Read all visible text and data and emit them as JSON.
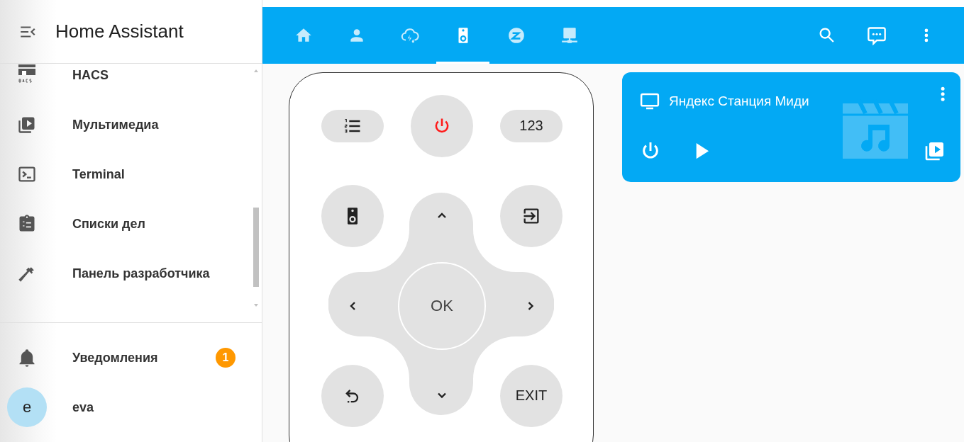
{
  "sidebar": {
    "title": "Home Assistant",
    "items": [
      {
        "label": "HACS"
      },
      {
        "label": "Мультимедиа"
      },
      {
        "label": "Terminal"
      },
      {
        "label": "Списки дел"
      },
      {
        "label": "Панель разработчика"
      }
    ],
    "notifications": {
      "label": "Уведомления",
      "badge": "1"
    },
    "user": {
      "initial": "e",
      "name": "eva"
    }
  },
  "header": {
    "tabs": [
      {
        "selected": false
      },
      {
        "selected": false
      },
      {
        "selected": false
      },
      {
        "selected": true
      },
      {
        "selected": false
      },
      {
        "selected": false
      }
    ]
  },
  "remote": {
    "keys": [
      {
        "kind": "pill"
      },
      {
        "kind": "round"
      },
      {
        "kind": "pill",
        "label": "123"
      },
      {
        "kind": "round"
      },
      {
        "kind": "arrow"
      },
      {
        "kind": "round"
      },
      {
        "kind": "arrow"
      },
      {
        "kind": "ok",
        "label": "OK"
      },
      {
        "kind": "arrow"
      },
      {
        "kind": "round"
      },
      {
        "kind": "arrow"
      },
      {
        "kind": "round",
        "label": "EXIT"
      }
    ]
  },
  "media_card": {
    "name": "Яндекс Станция Миди"
  }
}
